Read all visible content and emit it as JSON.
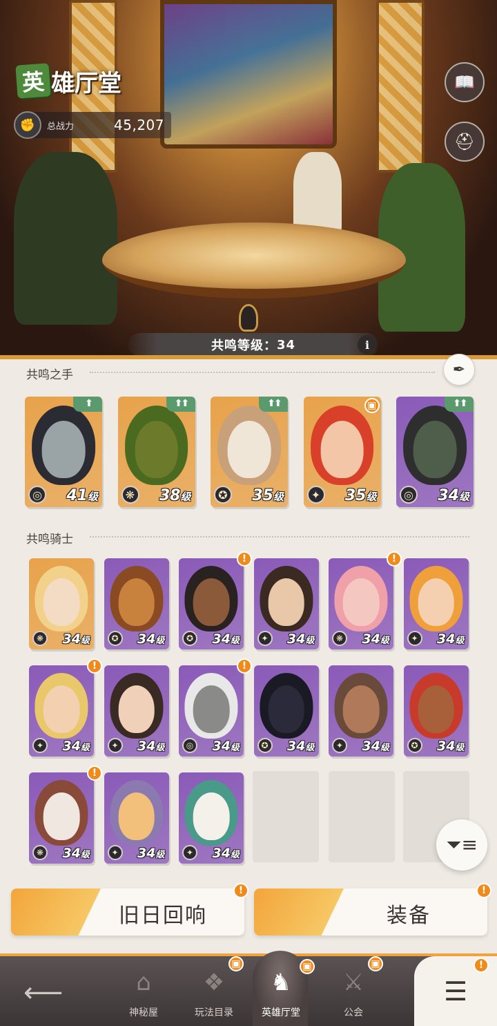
{
  "header": {
    "title_first_char": "英",
    "title_rest": "雄厅堂",
    "power_label": "总战力",
    "power_value": "45,207"
  },
  "side_buttons": [
    {
      "name": "book-button",
      "icon": "book-icon"
    },
    {
      "name": "heroes-button",
      "icon": "helmets-icon"
    }
  ],
  "resonance": {
    "label": "共鸣等级：",
    "level": "34",
    "info": "i"
  },
  "sections": {
    "hands": "共鸣之手",
    "knights": "共鸣骑士"
  },
  "hands": [
    {
      "level": "41",
      "unit": "级",
      "bg": "#e8a24a",
      "skin": "#9aa3a6",
      "hair": "#2b2b33",
      "badge": "arrow",
      "faction": "◎"
    },
    {
      "level": "38",
      "unit": "级",
      "bg": "#e8a24a",
      "skin": "#6c7a2c",
      "hair": "#4a6a20",
      "badge": "arrow",
      "faction": "❋"
    },
    {
      "level": "35",
      "unit": "级",
      "bg": "#e8a24a",
      "skin": "#f0e6d8",
      "hair": "#c8a07a",
      "badge": "arrow",
      "faction": "✪"
    },
    {
      "level": "35",
      "unit": "级",
      "bg": "#e8a24a",
      "skin": "#f3c6a8",
      "hair": "#d8402a",
      "badge": "gift",
      "faction": "✦"
    },
    {
      "level": "34",
      "unit": "级",
      "bg": "#8a5ab8",
      "skin": "#4e5e4a",
      "hair": "#2e2e2e",
      "badge": "arrow",
      "faction": "◎"
    }
  ],
  "knights": [
    {
      "level": "34",
      "unit": "级",
      "bg": "#e8a24a",
      "skin": "#f4dcc4",
      "hair": "#f2d28a",
      "gift": false,
      "faction": "❋"
    },
    {
      "level": "34",
      "unit": "级",
      "bg": "#8a5ab8",
      "skin": "#c9823e",
      "hair": "#8a4a22",
      "gift": false,
      "faction": "✪"
    },
    {
      "level": "34",
      "unit": "级",
      "bg": "#8a5ab8",
      "skin": "#8a5a3a",
      "hair": "#2a2220",
      "gift": true,
      "faction": "✪"
    },
    {
      "level": "34",
      "unit": "级",
      "bg": "#8a5ab8",
      "skin": "#e8c8a8",
      "hair": "#3a2a22",
      "gift": false,
      "faction": "✦"
    },
    {
      "level": "34",
      "unit": "级",
      "bg": "#8a5ab8",
      "skin": "#f4c8c0",
      "hair": "#f0a0a8",
      "gift": true,
      "faction": "❋"
    },
    {
      "level": "34",
      "unit": "级",
      "bg": "#8a5ab8",
      "skin": "#f4d0b0",
      "hair": "#f0a03a",
      "gift": false,
      "faction": "✦"
    },
    {
      "level": "34",
      "unit": "级",
      "bg": "#8a5ab8",
      "skin": "#f2d0b0",
      "hair": "#e8c86a",
      "gift": true,
      "faction": "✦"
    },
    {
      "level": "34",
      "unit": "级",
      "bg": "#8a5ab8",
      "skin": "#f0d0b8",
      "hair": "#3a2a24",
      "gift": false,
      "faction": "✦"
    },
    {
      "level": "34",
      "unit": "级",
      "bg": "#8a5ab8",
      "skin": "#8a8a88",
      "hair": "#e8e8e8",
      "gift": true,
      "faction": "◎"
    },
    {
      "level": "34",
      "unit": "级",
      "bg": "#8a5ab8",
      "skin": "#2a2a3a",
      "hair": "#1a1a24",
      "gift": false,
      "faction": "✪"
    },
    {
      "level": "34",
      "unit": "级",
      "bg": "#8a5ab8",
      "skin": "#b07a5a",
      "hair": "#6a4a3a",
      "gift": false,
      "faction": "✦"
    },
    {
      "level": "34",
      "unit": "级",
      "bg": "#8a5ab8",
      "skin": "#a8603a",
      "hair": "#c83a2a",
      "gift": false,
      "faction": "✪"
    },
    {
      "level": "34",
      "unit": "级",
      "bg": "#8a5ab8",
      "skin": "#f0e8e0",
      "hair": "#8a4a3a",
      "gift": true,
      "faction": "❋"
    },
    {
      "level": "34",
      "unit": "级",
      "bg": "#8a5ab8",
      "skin": "#f2c07a",
      "hair": "#8a7ab0",
      "gift": false,
      "faction": "✦"
    },
    {
      "level": "34",
      "unit": "级",
      "bg": "#8a5ab8",
      "skin": "#f4f0ea",
      "hair": "#4a9a8a",
      "gift": false,
      "faction": "✦"
    }
  ],
  "actions": {
    "echo": "旧日回响",
    "equip": "装备"
  },
  "nav": {
    "items": [
      {
        "label": "神秘屋",
        "icon": "tower-icon",
        "gift": false
      },
      {
        "label": "玩法目录",
        "icon": "diamond-grid-icon",
        "gift": true
      },
      {
        "label": "英雄厅堂",
        "icon": "knight-helmet-icon",
        "gift": true,
        "active": true
      },
      {
        "label": "公会",
        "icon": "crossed-swords-icon",
        "gift": true
      }
    ]
  },
  "colors": {
    "accent": "#f0a33c",
    "gift": "#f08a1a",
    "upgrade": "#5a9a6c",
    "panel": "#efebe4"
  }
}
